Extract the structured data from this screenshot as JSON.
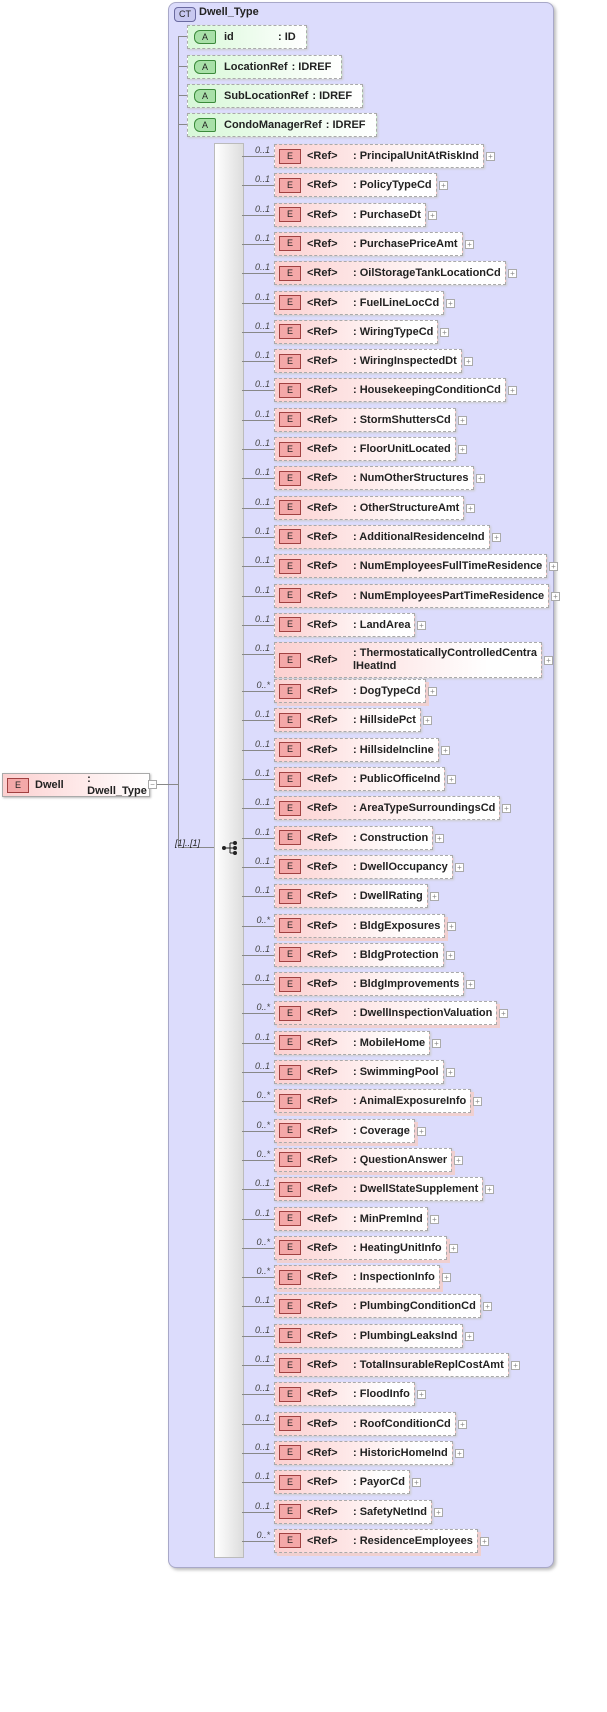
{
  "root": {
    "badge": "E",
    "name": "Dwell",
    "type": ": Dwell_Type"
  },
  "complex_type": {
    "badge": "CT",
    "name": "Dwell_Type"
  },
  "attributes": [
    {
      "badge": "A",
      "name": "id",
      "type": ": ID"
    },
    {
      "badge": "A",
      "name": "LocationRef",
      "type": ": IDREF"
    },
    {
      "badge": "A",
      "name": "SubLocationRef",
      "type": ": IDREF"
    },
    {
      "badge": "A",
      "name": "CondoManagerRef",
      "type": ": IDREF"
    }
  ],
  "sequence": {
    "cardinality": "[1]..[1]"
  },
  "element_badge": "E",
  "ref_label": "<Ref>",
  "elements": [
    {
      "card": "0..1",
      "name": ": PrincipalUnitAtRiskInd"
    },
    {
      "card": "0..1",
      "name": ": PolicyTypeCd"
    },
    {
      "card": "0..1",
      "name": ": PurchaseDt"
    },
    {
      "card": "0..1",
      "name": ": PurchasePriceAmt"
    },
    {
      "card": "0..1",
      "name": ": OilStorageTankLocationCd"
    },
    {
      "card": "0..1",
      "name": ": FuelLineLocCd"
    },
    {
      "card": "0..1",
      "name": ": WiringTypeCd"
    },
    {
      "card": "0..1",
      "name": ": WiringInspectedDt"
    },
    {
      "card": "0..1",
      "name": ": HousekeepingConditionCd"
    },
    {
      "card": "0..1",
      "name": ": StormShuttersCd"
    },
    {
      "card": "0..1",
      "name": ": FloorUnitLocated"
    },
    {
      "card": "0..1",
      "name": ": NumOtherStructures"
    },
    {
      "card": "0..1",
      "name": ": OtherStructureAmt"
    },
    {
      "card": "0..1",
      "name": ": AdditionalResidenceInd"
    },
    {
      "card": "0..1",
      "name": ": NumEmployeesFullTimeResidence"
    },
    {
      "card": "0..1",
      "name": ": NumEmployeesPartTimeResidence"
    },
    {
      "card": "0..1",
      "name": ": LandArea"
    },
    {
      "card": "0..1",
      "name": ": ThermostaticallyControlledCentralHeatInd"
    },
    {
      "card": "0..*",
      "name": ": DogTypeCd"
    },
    {
      "card": "0..1",
      "name": ": HillsidePct"
    },
    {
      "card": "0..1",
      "name": ": HillsideIncline"
    },
    {
      "card": "0..1",
      "name": ": PublicOfficeInd"
    },
    {
      "card": "0..1",
      "name": ": AreaTypeSurroundingsCd"
    },
    {
      "card": "0..1",
      "name": ": Construction"
    },
    {
      "card": "0..1",
      "name": ": DwellOccupancy"
    },
    {
      "card": "0..1",
      "name": ": DwellRating"
    },
    {
      "card": "0..*",
      "name": ": BldgExposures"
    },
    {
      "card": "0..1",
      "name": ": BldgProtection"
    },
    {
      "card": "0..1",
      "name": ": BldgImprovements"
    },
    {
      "card": "0..*",
      "name": ": DwellInspectionValuation"
    },
    {
      "card": "0..1",
      "name": ": MobileHome"
    },
    {
      "card": "0..1",
      "name": ": SwimmingPool"
    },
    {
      "card": "0..*",
      "name": ": AnimalExposureInfo"
    },
    {
      "card": "0..*",
      "name": ": Coverage"
    },
    {
      "card": "0..*",
      "name": ": QuestionAnswer"
    },
    {
      "card": "0..1",
      "name": ": DwellStateSupplement"
    },
    {
      "card": "0..1",
      "name": ": MinPremInd"
    },
    {
      "card": "0..*",
      "name": ": HeatingUnitInfo"
    },
    {
      "card": "0..*",
      "name": ": InspectionInfo"
    },
    {
      "card": "0..1",
      "name": ": PlumbingConditionCd"
    },
    {
      "card": "0..1",
      "name": ": PlumbingLeaksInd"
    },
    {
      "card": "0..1",
      "name": ": TotalInsurableReplCostAmt"
    },
    {
      "card": "0..1",
      "name": ": FloodInfo"
    },
    {
      "card": "0..1",
      "name": ": RoofConditionCd"
    },
    {
      "card": "0..1",
      "name": ": HistoricHomeInd"
    },
    {
      "card": "0..1",
      "name": ": PayorCd"
    },
    {
      "card": "0..1",
      "name": ": SafetyNetInd"
    },
    {
      "card": "0..*",
      "name": ": ResidenceEmployees"
    }
  ]
}
